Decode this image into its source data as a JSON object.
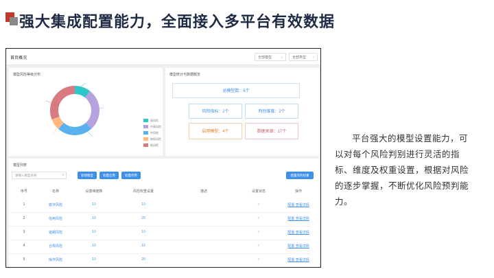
{
  "slide": {
    "title": "强大集成配置能力，全面接入多平台有效数据",
    "description": "平台强大的模型设置能力，可以对每个风险判别进行灵活的指标、维度及权重设置，根据对风险的逐步掌握，不断优化风险预判能力。"
  },
  "app": {
    "page_title": "首页概况",
    "filter_1": "全部模型",
    "filter_2": "全部类型",
    "donut_panel_title": "模型风险等级分布",
    "stats_panel_title": "模型统计与数据概览",
    "table_panel_title": "模型列表",
    "search_placeholder": "请输入模型名称",
    "buttons": {
      "b1": "新建模型",
      "b2": "批量启用",
      "b3": "批量停用",
      "b4": "配置风险权重"
    },
    "legend": [
      {
        "label": "高风险",
        "color": "#2ec7c9"
      },
      {
        "label": "中高风险",
        "color": "#b6a2de"
      },
      {
        "label": "中风险",
        "color": "#5ab1ef"
      },
      {
        "label": "较低风险",
        "color": "#ffb980"
      },
      {
        "label": "低风险",
        "color": "#d87a80"
      }
    ],
    "stats": {
      "main": "总模型数：6个",
      "s1": "风险指标：2个",
      "s2": "判别维度：2个",
      "s3": "启用模型：4个",
      "s4": "数据来源：17个"
    },
    "columns": [
      "序号",
      "名称",
      "设置维度数",
      "风险权重设置",
      "描述",
      "设置状态",
      "操作"
    ],
    "rows": [
      {
        "no": "1",
        "name": "欺诈风险",
        "dim": "10",
        "weight": "10",
        "op": "配置 查看详情"
      },
      {
        "no": "2",
        "name": "信用风险",
        "dim": "10",
        "weight": "20",
        "op": "配置 查看详情"
      },
      {
        "no": "3",
        "name": "逾期风险",
        "dim": "10",
        "weight": "10",
        "op": "配置 查看详情"
      },
      {
        "no": "4",
        "name": "合规风险",
        "dim": "10",
        "weight": "10",
        "op": "配置 查看详情"
      },
      {
        "no": "5",
        "name": "操作风险",
        "dim": "10",
        "weight": "20",
        "op": "配置 查看详情"
      }
    ],
    "status_icon": "check-icon"
  }
}
